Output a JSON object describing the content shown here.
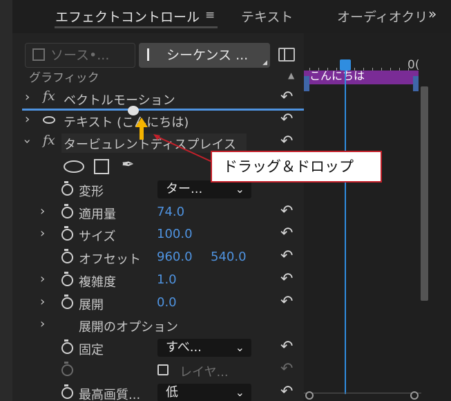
{
  "tabs": [
    {
      "label": "エフェクトコントロール",
      "active": true
    },
    {
      "label": "テキスト",
      "active": false
    },
    {
      "label": "オーディオクリ",
      "active": false
    }
  ],
  "tab_menu_icon": "≡",
  "overflow_icon": "»",
  "source_button": {
    "label": "ソース•..."
  },
  "sequence_button": {
    "label": "シーケンス ..."
  },
  "timeline": {
    "ruler_label": "0(",
    "clip_label": "こんにちは",
    "accent_color": "#2f8de0",
    "clip_color": "#7a2c96"
  },
  "section_label": "グラフィック",
  "effects": {
    "vector_motion": "ベクトルモーション",
    "text": "テキスト (こんにちは)",
    "turbulent": "タービュレントディスプレイス"
  },
  "properties": {
    "transform": {
      "label": "変形",
      "value": "ター..."
    },
    "amount": {
      "label": "適用量",
      "value": "74.0"
    },
    "size": {
      "label": "サイズ",
      "value": "100.0"
    },
    "offset": {
      "label": "オフセット",
      "x": "960.0",
      "y": "540.0"
    },
    "complexity": {
      "label": "複雑度",
      "value": "1.0"
    },
    "evolution": {
      "label": "展開",
      "value": "0.0"
    },
    "evolution_options": {
      "label": "展開のオプション"
    },
    "pinning": {
      "label": "固定",
      "value": "すべ..."
    },
    "layer": {
      "label": "レイヤ..."
    },
    "quality": {
      "label": "最高画質...",
      "value": "低"
    }
  },
  "annotation": {
    "label": "ドラッグ＆ドロップ",
    "border_color": "#c4202a",
    "arrow_color": "#f5b400"
  }
}
